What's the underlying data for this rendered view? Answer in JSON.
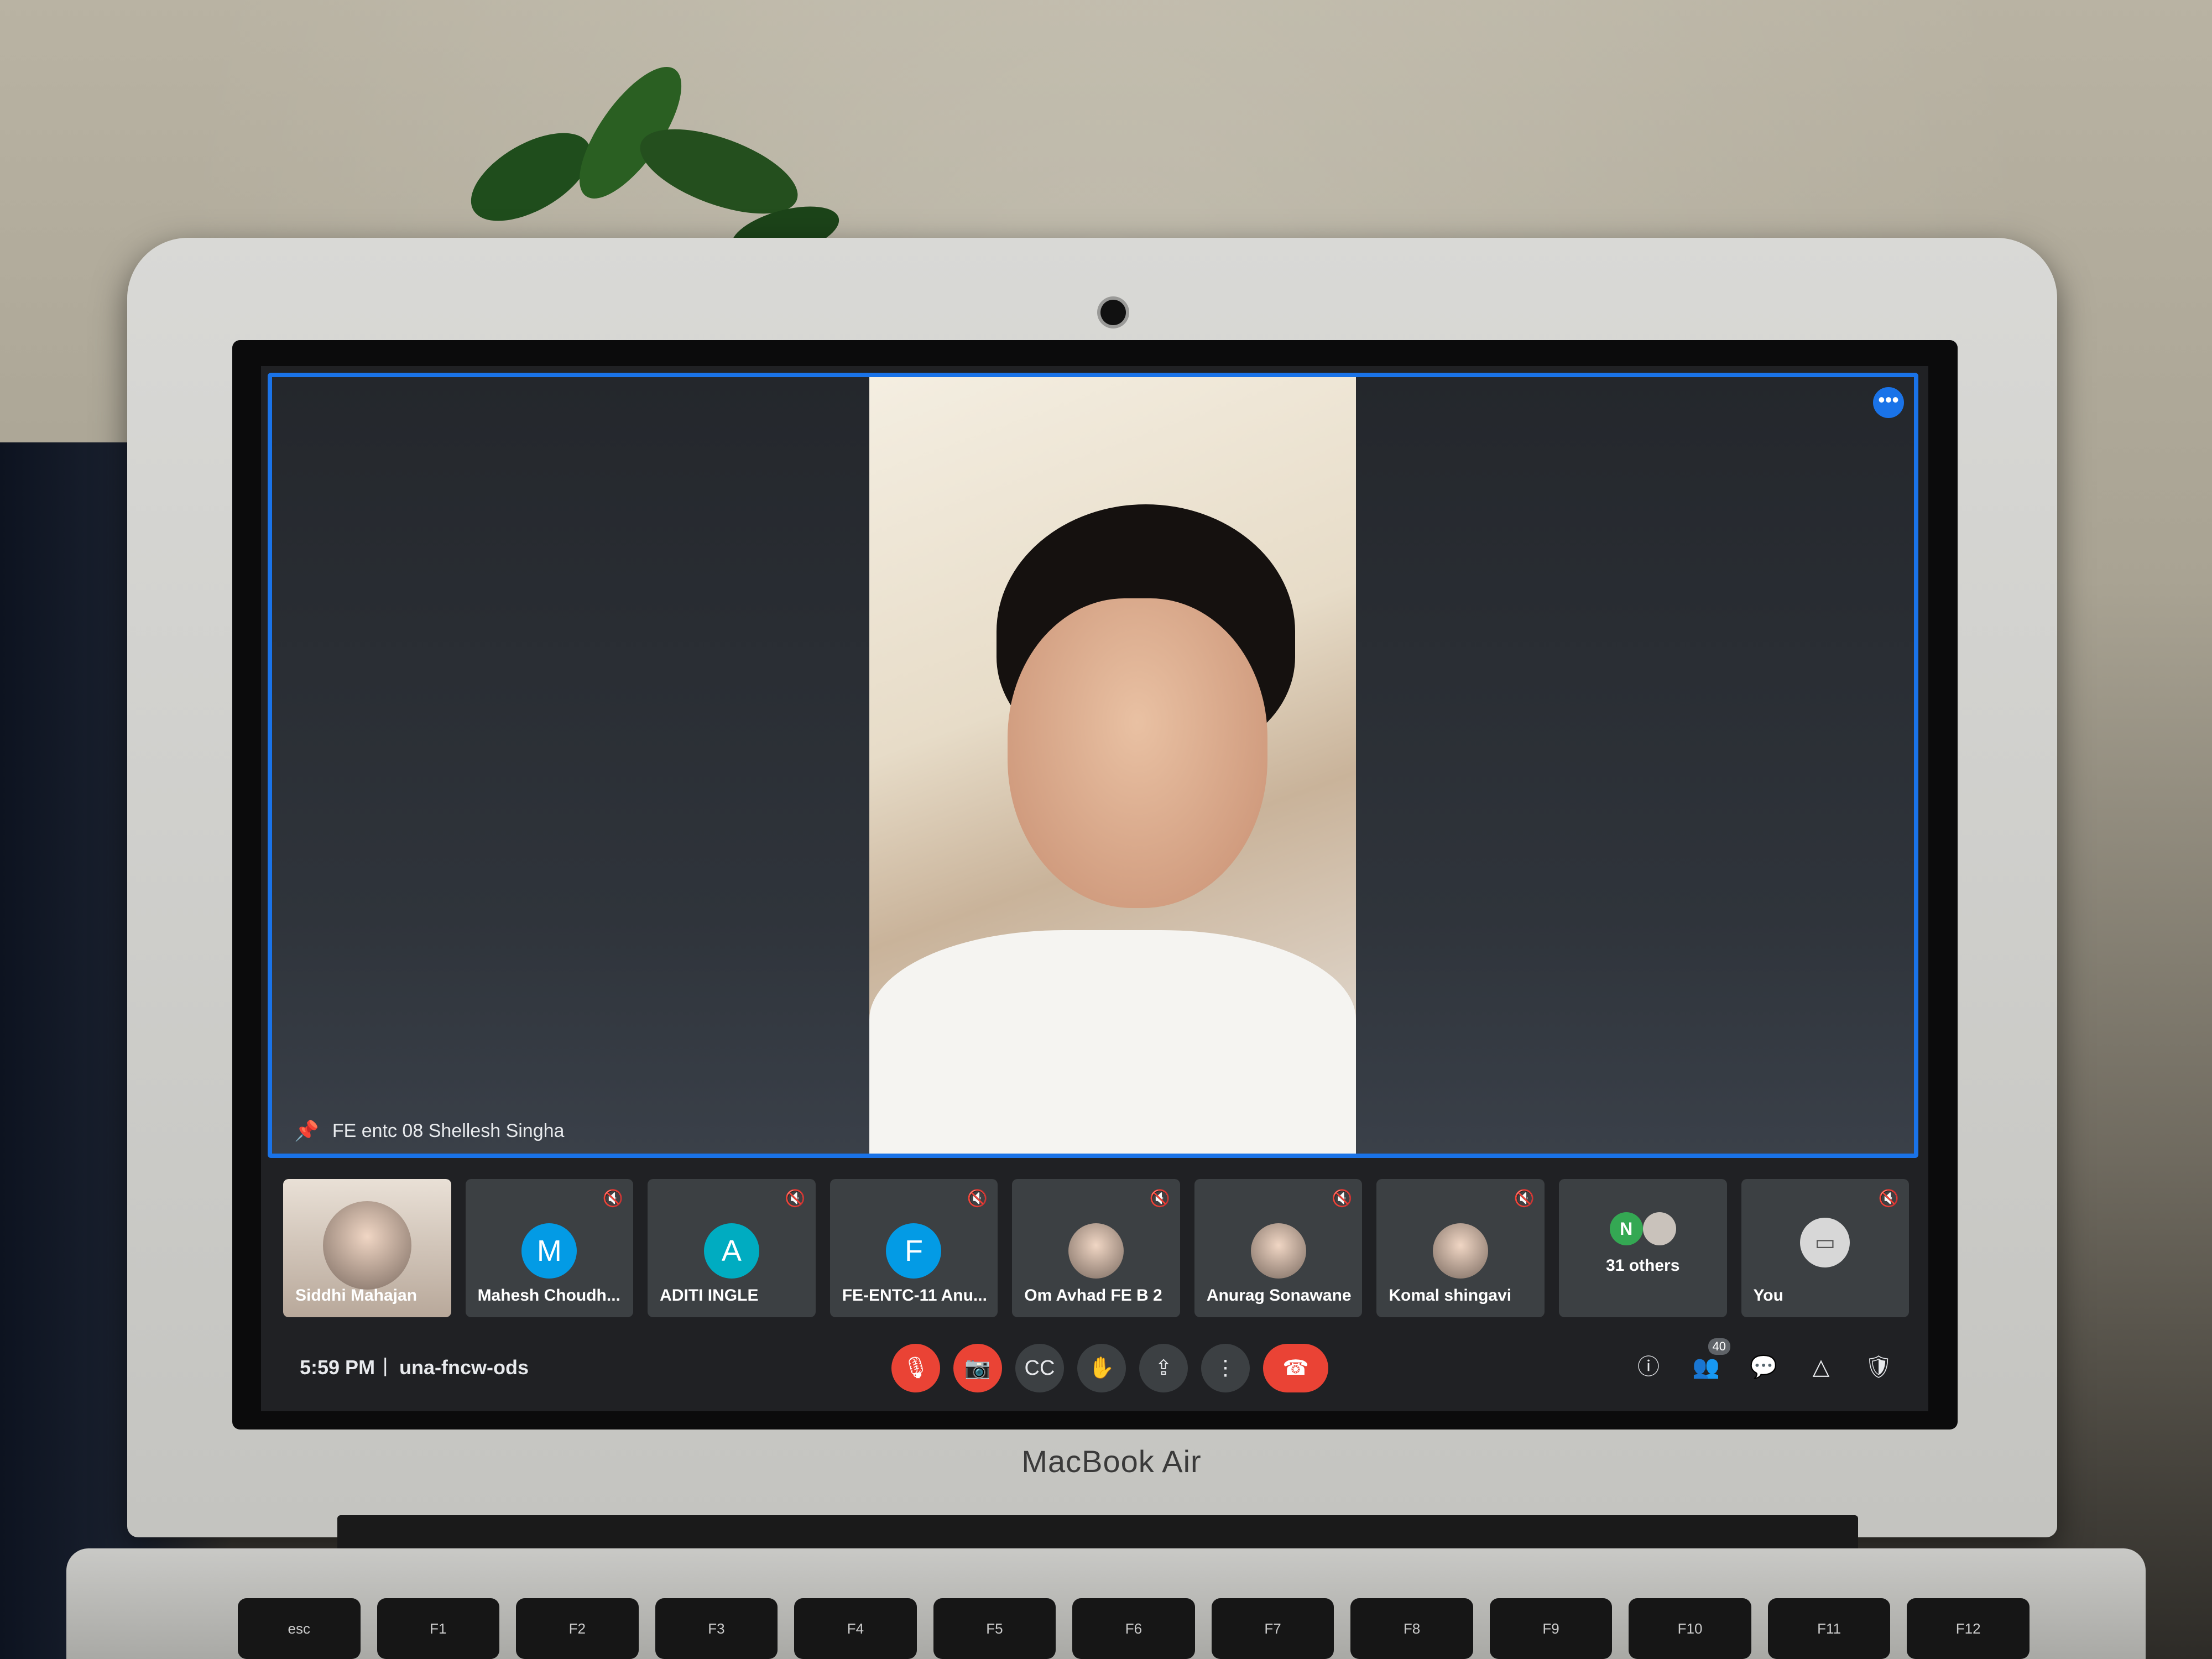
{
  "meeting": {
    "time": "5:59 PM",
    "separator": "|",
    "code": "una-fncw-ods",
    "active_speaker": "FE entc 08 Shellesh Singha",
    "people_count": "40"
  },
  "participants": [
    {
      "name": "Siddhi Mahajan",
      "type": "video"
    },
    {
      "name": "Mahesh Choudh...",
      "initial": "M",
      "color": "#039be5"
    },
    {
      "name": "ADITI INGLE",
      "initial": "A",
      "color": "#00acc1"
    },
    {
      "name": "FE-ENTC-11 Anu...",
      "initial": "F",
      "color": "#039be5"
    },
    {
      "name": "Om Avhad FE B 2",
      "type": "photo"
    },
    {
      "name": "Anurag Sonawane",
      "type": "photo"
    },
    {
      "name": "Komal shingavi",
      "type": "photo"
    }
  ],
  "others": {
    "label": "31 others",
    "initial": "N",
    "color": "#34a853"
  },
  "self": {
    "label": "You"
  },
  "device": {
    "brand": "MacBook Air"
  },
  "keyboard": [
    "esc",
    "F1",
    "F2",
    "F3",
    "F4",
    "F5",
    "F6",
    "F7",
    "F8",
    "F9",
    "F10",
    "F11",
    "F12"
  ],
  "colors": {
    "accent": "#1a73e8",
    "danger": "#ea4335",
    "bar": "#202124",
    "tile": "#3c4043"
  },
  "icons": {
    "more": "more-horizontal-icon",
    "pin": "pin-icon",
    "mic_off": "mic-off-icon",
    "camera_off": "camera-off-icon",
    "captions": "captions-icon",
    "hand": "raise-hand-icon",
    "present": "present-icon",
    "options": "more-vertical-icon",
    "end_call": "end-call-icon",
    "info": "info-icon",
    "people": "people-icon",
    "chat": "chat-icon",
    "activities": "activities-icon",
    "host": "host-controls-icon"
  }
}
